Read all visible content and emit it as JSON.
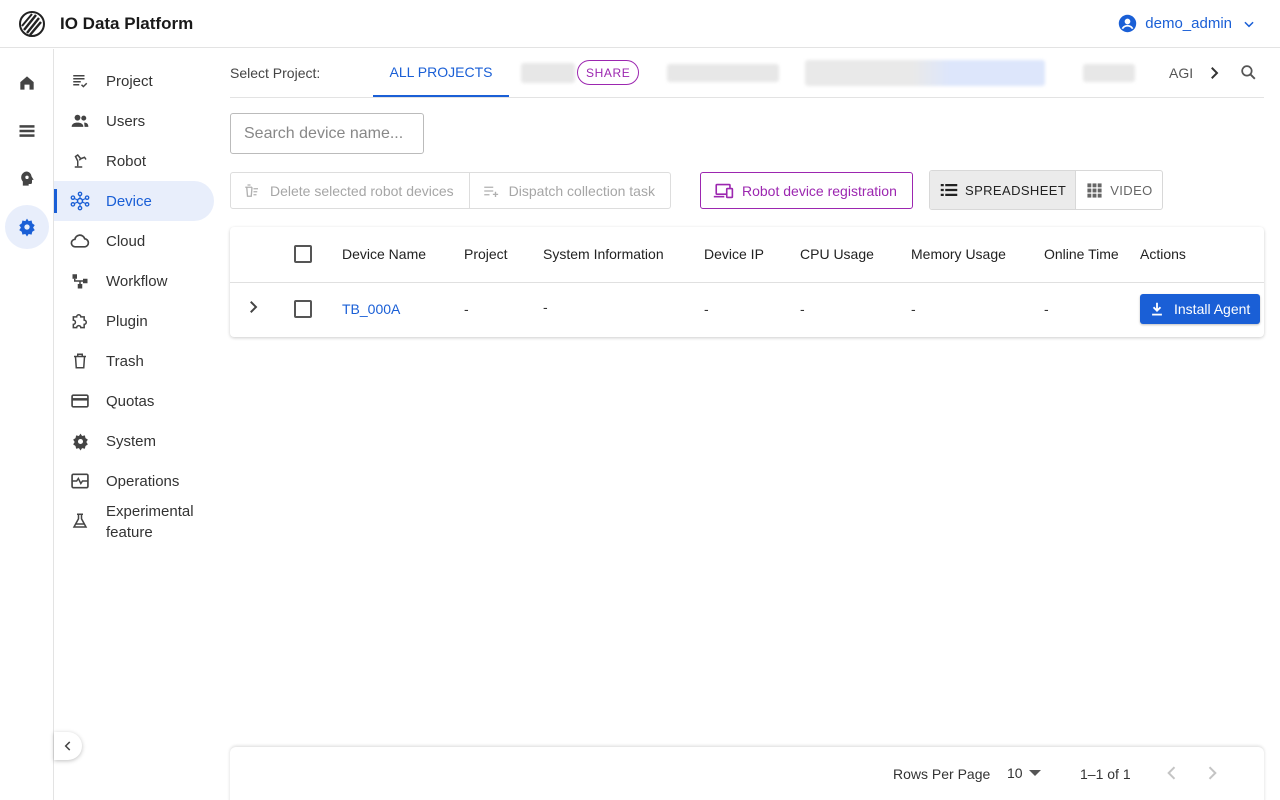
{
  "app": {
    "title": "IO Data Platform",
    "user": "demo_admin"
  },
  "rail": [
    "home-icon",
    "storage-icon",
    "psychology-icon",
    "settings-icon"
  ],
  "sidebar": {
    "items": [
      {
        "label": "Project",
        "icon": "project-icon"
      },
      {
        "label": "Users",
        "icon": "users-icon"
      },
      {
        "label": "Robot",
        "icon": "robot-arm-icon"
      },
      {
        "label": "Device",
        "icon": "device-hub-icon",
        "active": true
      },
      {
        "label": "Cloud",
        "icon": "cloud-icon"
      },
      {
        "label": "Workflow",
        "icon": "workflow-icon"
      },
      {
        "label": "Plugin",
        "icon": "plugin-icon"
      },
      {
        "label": "Trash",
        "icon": "trash-icon"
      },
      {
        "label": "Quotas",
        "icon": "credit-card-icon"
      },
      {
        "label": "System",
        "icon": "gear-icon"
      },
      {
        "label": "Operations",
        "icon": "monitor-heart-icon"
      },
      {
        "label": "Experimental feature",
        "icon": "flask-icon"
      }
    ]
  },
  "projects": {
    "label": "Select Project:",
    "tabs": [
      {
        "label": "ALL PROJECTS",
        "active": true
      },
      {
        "label": "",
        "badge": "SHARE"
      },
      {
        "label": ""
      },
      {
        "label": ""
      },
      {
        "label": ""
      },
      {
        "label": "AGI"
      }
    ]
  },
  "search": {
    "placeholder": "Search device name...",
    "value": ""
  },
  "toolbar": {
    "delete_label": "Delete selected robot devices",
    "dispatch_label": "Dispatch collection task",
    "register_label": "Robot device registration",
    "view_spreadsheet": "SPREADSHEET",
    "view_video": "VIDEO",
    "selected_view": "SPREADSHEET"
  },
  "table": {
    "columns": [
      "Device Name",
      "Project",
      "System Information",
      "Device IP",
      "CPU Usage",
      "Memory Usage",
      "Online Time",
      "Actions"
    ],
    "rows": [
      {
        "device_name": "TB_000A",
        "project": "-",
        "system_info": "-",
        "device_ip": "-",
        "cpu": "-",
        "memory": "-",
        "online_time": "-",
        "action": "Install Agent"
      }
    ]
  },
  "pagination": {
    "rows_per_page_label": "Rows Per Page",
    "rows_per_page": "10",
    "range": "1–1 of 1"
  },
  "colors": {
    "primary": "#1a5fd6",
    "secondary": "#9c27b0",
    "active_bg": "#e8eefb"
  }
}
